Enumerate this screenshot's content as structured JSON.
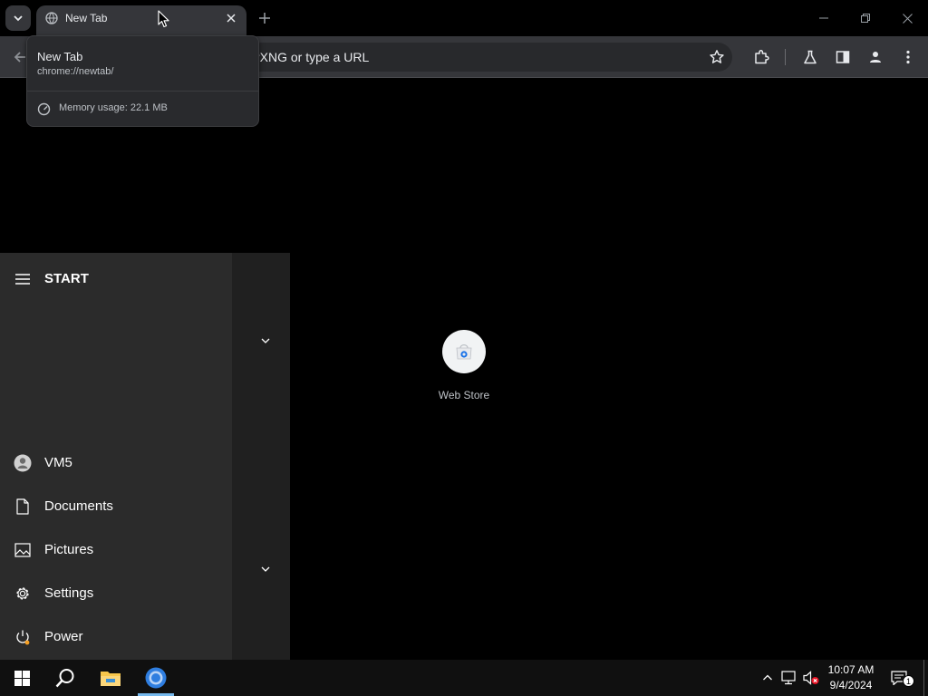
{
  "browser": {
    "tab": {
      "title": "New Tab"
    },
    "omnibox": {
      "text": "rXNG or type a URL"
    },
    "hovercard": {
      "title": "New Tab",
      "url": "chrome://newtab/",
      "memory": "Memory usage: 22.1 MB"
    },
    "shortcuts": [
      {
        "label": "Web Store"
      }
    ]
  },
  "start_menu": {
    "title": "START",
    "items": [
      {
        "label": "VM5",
        "icon": "user-icon"
      },
      {
        "label": "Documents",
        "icon": "document-icon"
      },
      {
        "label": "Pictures",
        "icon": "pictures-icon"
      },
      {
        "label": "Settings",
        "icon": "gear-icon"
      },
      {
        "label": "Power",
        "icon": "power-icon"
      }
    ]
  },
  "taskbar": {
    "time": "10:07 AM",
    "date": "9/4/2024",
    "notifications_count": "1"
  },
  "colors": {
    "accent": "#76b9ed",
    "tab_active": "#35363a",
    "start_bg": "#2b2b2b"
  }
}
